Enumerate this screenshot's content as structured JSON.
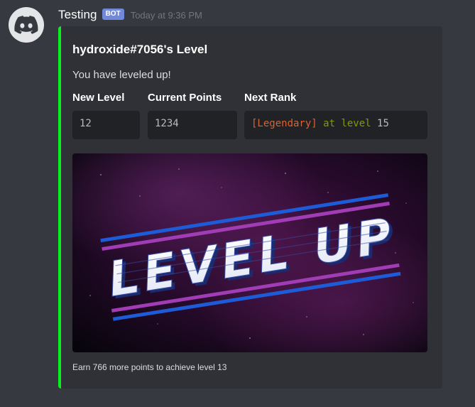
{
  "message": {
    "username": "Testing",
    "bot_tag": "BOT",
    "timestamp": "Today at 9:36 PM",
    "avatar_icon": "discord-logo-icon"
  },
  "embed": {
    "accent_color": "#0cef1e",
    "title": "hydroxide#7056's Level",
    "description": "You have leveled up!",
    "fields": [
      {
        "name": "New Level",
        "value": "12"
      },
      {
        "name": "Current Points",
        "value": "1234"
      },
      {
        "name": "Next Rank",
        "value_rank": "[Legendary]",
        "value_at": "at level",
        "value_level": "15"
      }
    ],
    "image_text": "LEVEL UP",
    "footer": "Earn 766 more points to achieve level 13"
  }
}
